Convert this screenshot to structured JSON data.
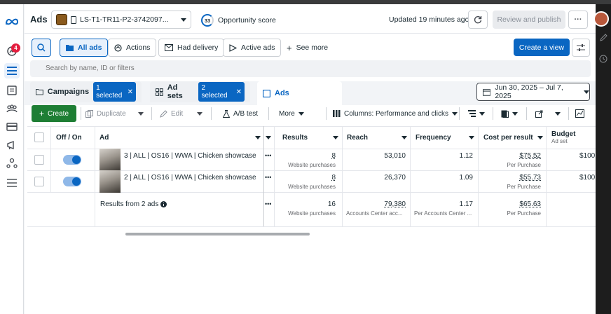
{
  "app": {
    "title": "Ads",
    "notification_count": "4"
  },
  "header": {
    "account_name": "LS-T1-TR11-P2-3742097...",
    "opportunity_score": "33",
    "opportunity_label": "Opportunity score",
    "updated": "Updated 19 minutes ago",
    "review_publish": "Review and publish",
    "more": "···"
  },
  "toolbar": {
    "all_ads": "All ads",
    "actions": "Actions",
    "had_delivery": "Had delivery",
    "active_ads": "Active ads",
    "see_more": "See more",
    "create_view": "Create a view"
  },
  "search": {
    "placeholder": "Search by name, ID or filters"
  },
  "tabs": {
    "campaigns": "Campaigns",
    "campaigns_chip": "1 selected",
    "adsets": "Ad sets",
    "adsets_chip": "2 selected",
    "ads": "Ads"
  },
  "date_range": "Jun 30, 2025 – Jul 7, 2025",
  "actions_bar": {
    "create": "Create",
    "duplicate": "Duplicate",
    "edit": "Edit",
    "ab_test": "A/B test",
    "more": "More",
    "columns": "Columns: Performance and clicks"
  },
  "table": {
    "headers": {
      "off_on": "Off / On",
      "ad": "Ad",
      "results": "Results",
      "reach": "Reach",
      "frequency": "Frequency",
      "cost_per_result": "Cost per result",
      "budget": "Budget",
      "budget_sub": "Ad set"
    },
    "rows": [
      {
        "name": "3 | ALL | OS16 | WWA | Chicken showcase",
        "results": "8",
        "results_sub": "Website purchases",
        "reach": "53,010",
        "frequency": "1.12",
        "cost": "$75.52",
        "cost_sub": "Per Purchase",
        "budget": "$100"
      },
      {
        "name": "2 | ALL | OS16 | WWA | Chicken showcase",
        "results": "8",
        "results_sub": "Website purchases",
        "reach": "26,370",
        "frequency": "1.09",
        "cost": "$55.73",
        "cost_sub": "Per Purchase",
        "budget": "$100"
      }
    ],
    "summary": {
      "label": "Results from 2 ads",
      "results": "16",
      "results_sub": "Website purchases",
      "reach": "79,380",
      "reach_sub": "Accounts Center acc...",
      "frequency": "1.17",
      "frequency_sub": "Per Accounts Center ...",
      "cost": "$65.63",
      "cost_sub": "Per Purchase"
    }
  },
  "colors": {
    "accent": "#0a66c2",
    "create_green": "#1e7e34",
    "badge_red": "#e41e3f"
  }
}
